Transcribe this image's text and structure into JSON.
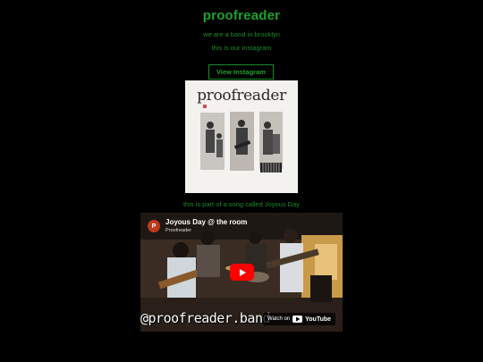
{
  "header": {
    "title": "proofreader",
    "tagline": "we are a band in brooklyn",
    "instagram_line": "this is our instagram",
    "instagram_button": "View Instagram"
  },
  "album": {
    "cover_title": "proofreader"
  },
  "song": {
    "caption": "this is part of a song called Joyous Day"
  },
  "video": {
    "title": "Joyous Day @ the room",
    "channel": "Proofreader",
    "avatar_letter": "P",
    "watch_on": "Watch on",
    "brand": "YouTube",
    "overlay_handle": "@proofreader.band"
  },
  "colors": {
    "background": "#000000",
    "accent_green": "#1fa02c",
    "play_red": "#ff0000"
  }
}
